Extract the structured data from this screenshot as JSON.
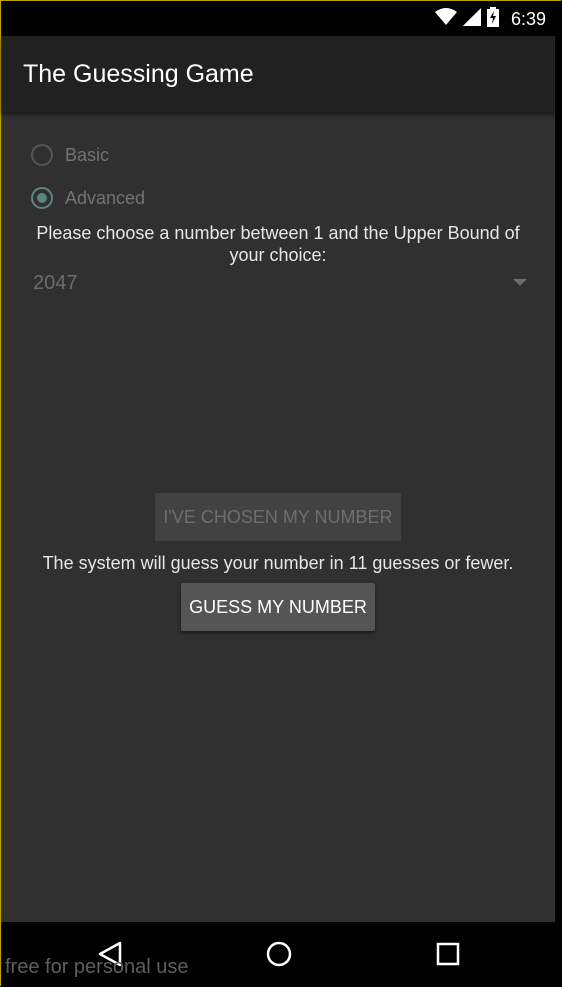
{
  "status_bar": {
    "time": "6:39",
    "icons": [
      "wifi-icon",
      "cell-signal-icon",
      "battery-charging-icon"
    ]
  },
  "app_bar": {
    "title": "The Guessing Game"
  },
  "mode": {
    "options": [
      {
        "label": "Basic",
        "checked": false,
        "enabled": false
      },
      {
        "label": "Advanced",
        "checked": true,
        "enabled": false
      }
    ]
  },
  "prompt": "Please choose a number between 1 and the Upper Bound of your choice:",
  "upper_bound": {
    "selected": "2047"
  },
  "actions": {
    "chosen_label": "I've Chosen My Number",
    "guess_label": "Guess My Number"
  },
  "info_text": "The system will guess your number in 11 guesses or fewer.",
  "nav_bar": {
    "icons": [
      "back-icon",
      "home-icon",
      "recents-icon"
    ]
  },
  "watermark": "free for personal use",
  "colors": {
    "content_bg": "#303030",
    "app_bar_bg": "#212121",
    "accent": "#5b8580"
  }
}
